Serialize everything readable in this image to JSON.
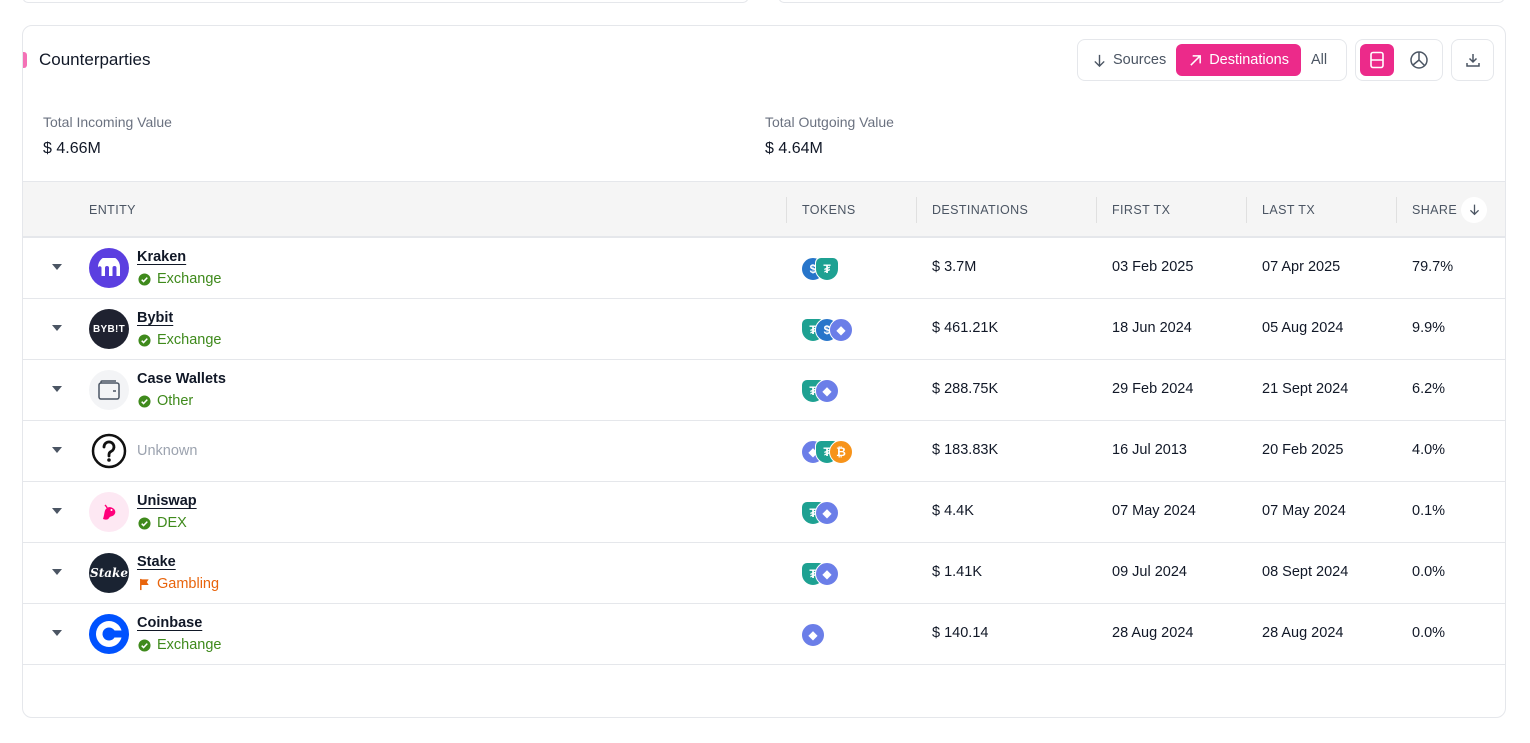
{
  "panel": {
    "title": "Counterparties"
  },
  "direction_toggle": {
    "sources": "Sources",
    "destinations": "Destinations",
    "all": "All"
  },
  "stats": {
    "incoming_label": "Total Incoming Value",
    "incoming_value": "$ 4.66M",
    "outgoing_label": "Total Outgoing Value",
    "outgoing_value": "$ 4.64M"
  },
  "table": {
    "headers": {
      "entity": "ENTITY",
      "tokens": "TOKENS",
      "destinations": "DESTINATIONS",
      "first_tx": "FIRST TX",
      "last_tx": "LAST TX",
      "share": "SHARE"
    },
    "rows": [
      {
        "name": "Kraken",
        "category": "Exchange",
        "category_icon": "verified-check-icon",
        "tokens": [
          "usdc",
          "usdt"
        ],
        "destinations": "$ 3.7M",
        "first_tx": "03 Feb 2025",
        "last_tx": "07 Apr 2025",
        "share": "79.7%"
      },
      {
        "name": "Bybit",
        "category": "Exchange",
        "category_icon": "verified-check-icon",
        "tokens": [
          "usdt",
          "usdc",
          "eth"
        ],
        "destinations": "$ 461.21K",
        "first_tx": "18 Jun 2024",
        "last_tx": "05 Aug 2024",
        "share": "9.9%"
      },
      {
        "name": "Case Wallets",
        "category": "Other",
        "category_icon": "verified-check-icon",
        "tokens": [
          "usdt",
          "eth"
        ],
        "destinations": "$ 288.75K",
        "first_tx": "29 Feb 2024",
        "last_tx": "21 Sept 2024",
        "share": "6.2%"
      },
      {
        "name": "Unknown",
        "category": "",
        "category_icon": "question-icon",
        "tokens": [
          "eth",
          "usdt",
          "btc"
        ],
        "destinations": "$ 183.83K",
        "first_tx": "16 Jul 2013",
        "last_tx": "20 Feb 2025",
        "share": "4.0%"
      },
      {
        "name": "Uniswap",
        "category": "DEX",
        "category_icon": "verified-check-icon",
        "tokens": [
          "usdt",
          "eth"
        ],
        "destinations": "$ 4.4K",
        "first_tx": "07 May 2024",
        "last_tx": "07 May 2024",
        "share": "0.1%"
      },
      {
        "name": "Stake",
        "category": "Gambling",
        "category_icon": "flag-icon",
        "tokens": [
          "usdt",
          "eth"
        ],
        "destinations": "$ 1.41K",
        "first_tx": "09 Jul 2024",
        "last_tx": "08 Sept 2024",
        "share": "0.0%"
      },
      {
        "name": "Coinbase",
        "category": "Exchange",
        "category_icon": "verified-check-icon",
        "tokens": [
          "eth"
        ],
        "destinations": "$ 140.14",
        "first_tx": "28 Aug 2024",
        "last_tx": "28 Aug 2024",
        "share": "0.0%"
      }
    ]
  },
  "logos": {
    "bybit_text": "BYB!T",
    "stake_text": "Stake"
  },
  "colors": {
    "accent": "#ec2a8a",
    "verified_green": "#3f8a1c",
    "gambling_orange": "#e8640c",
    "usdc": "#2775ca",
    "usdt": "#1ea192",
    "eth": "#6b7ee8",
    "btc": "#f7931a"
  }
}
